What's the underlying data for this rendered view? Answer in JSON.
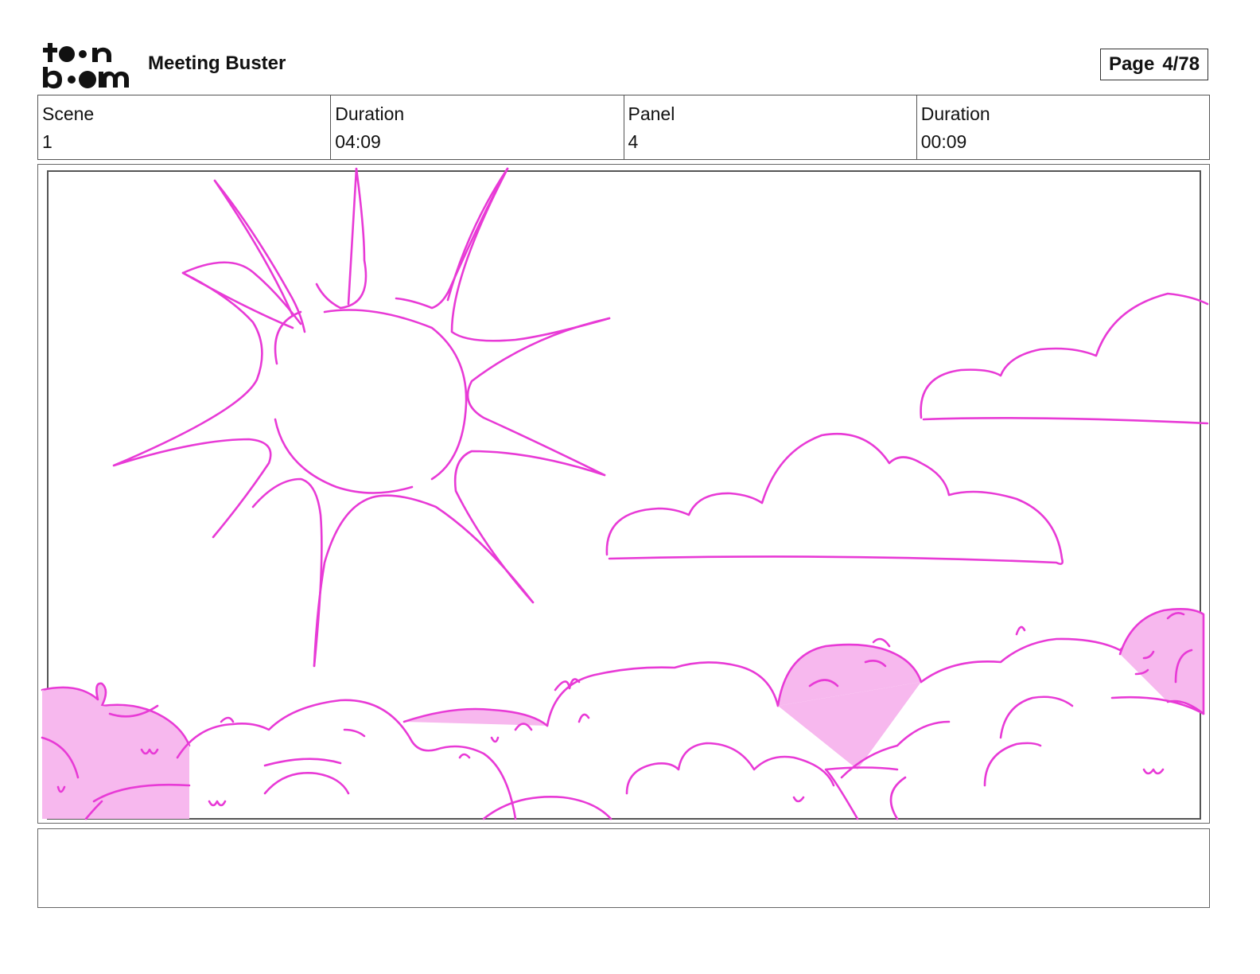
{
  "header": {
    "logo": {
      "line1": "toon",
      "line2": "boom"
    },
    "title": "Meeting Buster",
    "page_label": "Page",
    "page_value": "4/78"
  },
  "info": {
    "scene_label": "Scene",
    "scene_value": "1",
    "scene_duration_label": "Duration",
    "scene_duration_value": "04:09",
    "panel_label": "Panel",
    "panel_value": "4",
    "panel_duration_label": "Duration",
    "panel_duration_value": "00:09"
  },
  "drawing": {
    "description_icons": [
      "sun-drawing",
      "cloud-drawing",
      "cloud-drawing",
      "crowd-drawing"
    ],
    "stroke_color": "#e83ad6",
    "fill_color": "#f7b8ee"
  },
  "notes": {
    "text": ""
  }
}
